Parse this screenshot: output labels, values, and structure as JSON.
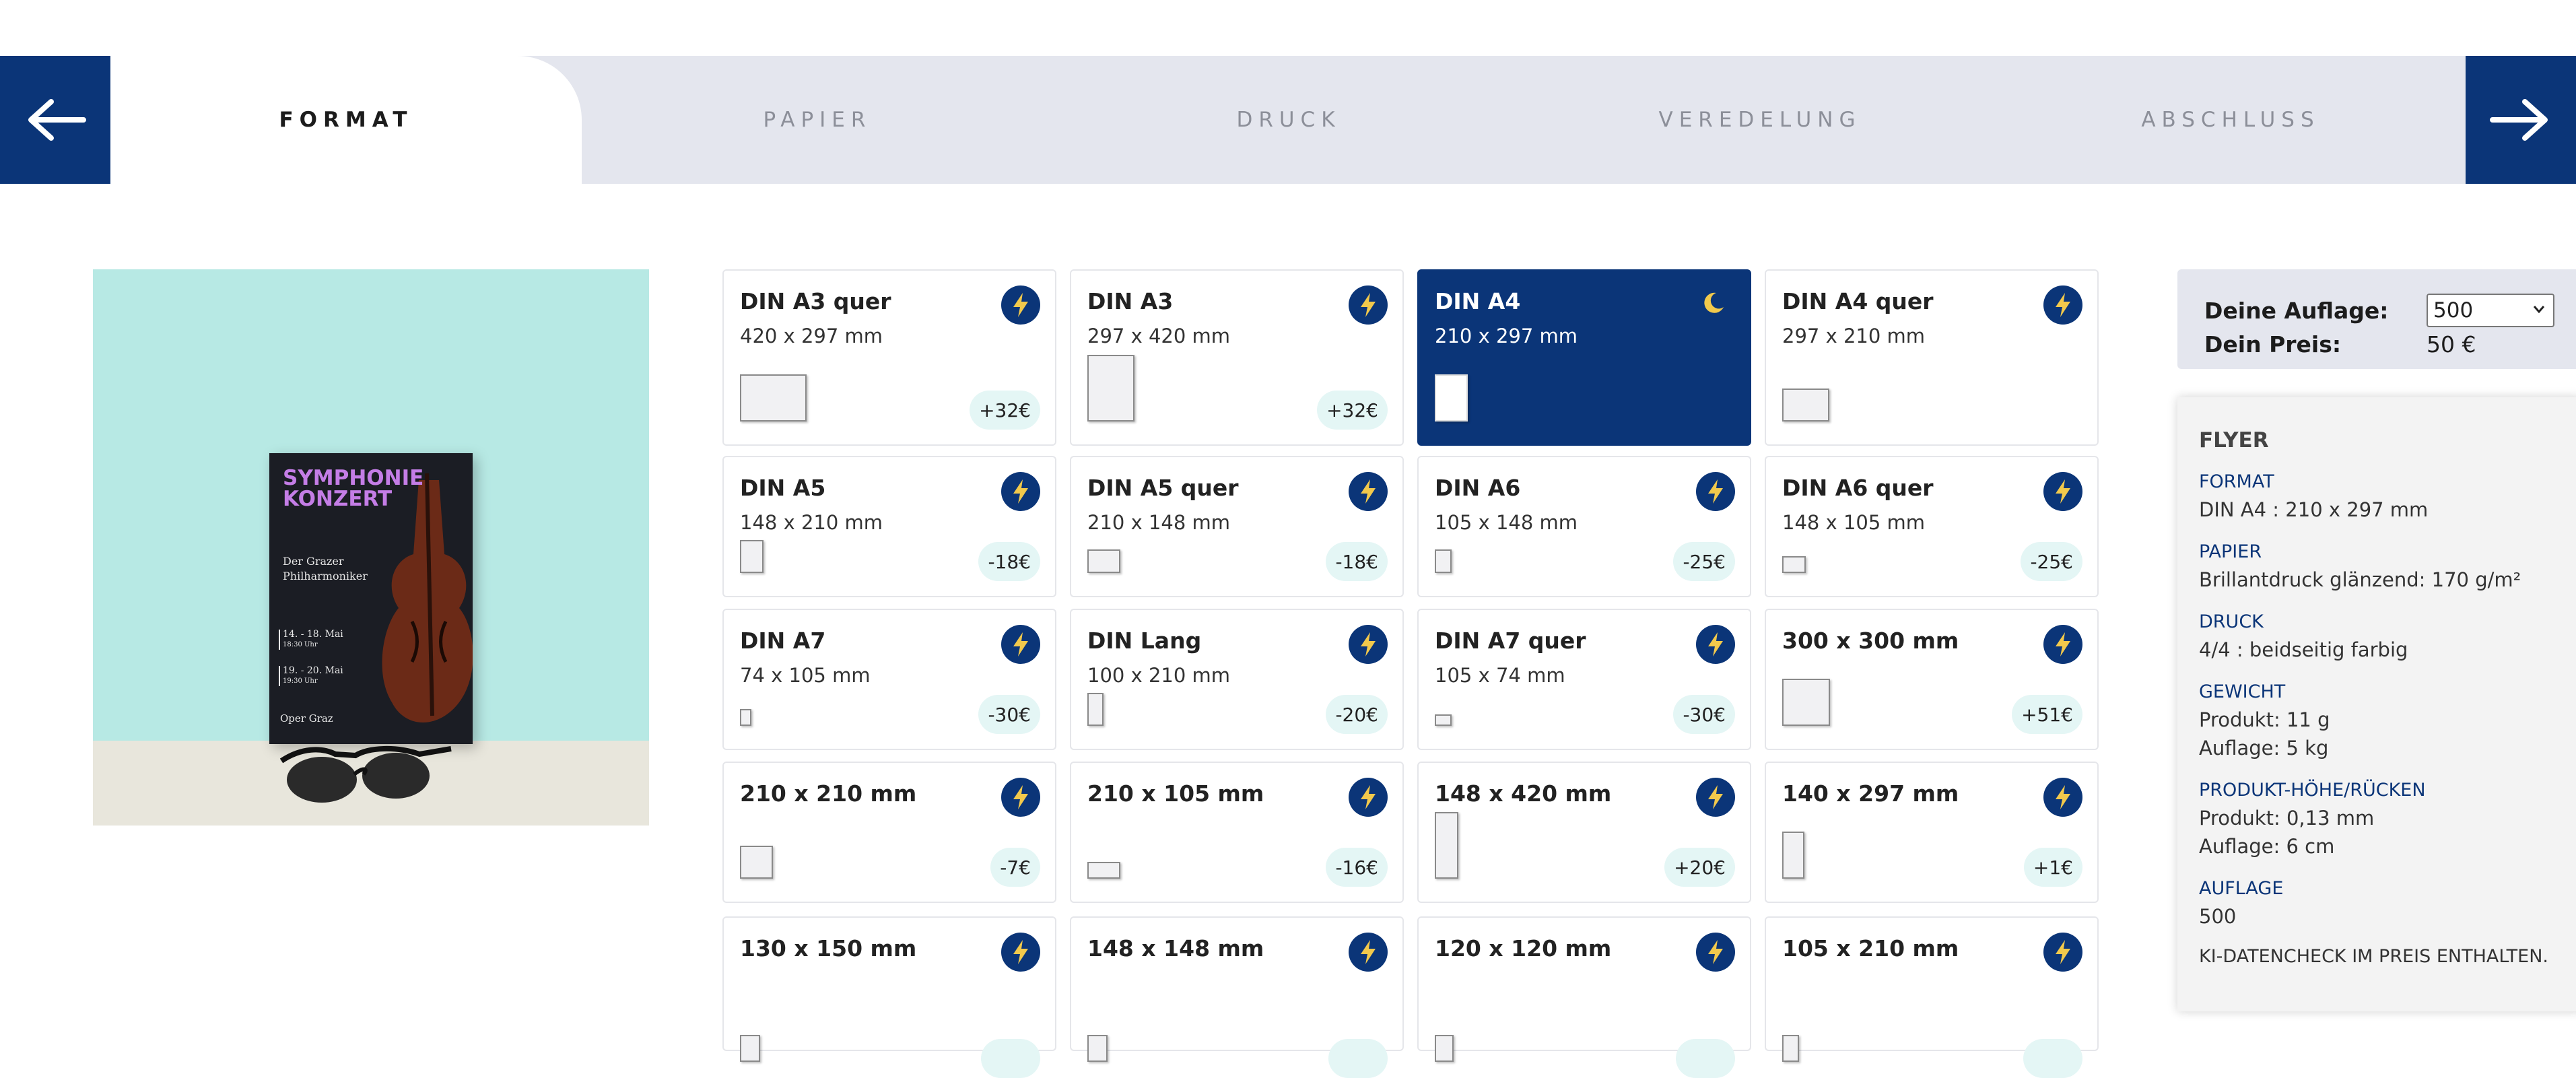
{
  "nav": {
    "prev_label": "←",
    "next_label": "→"
  },
  "steps": [
    {
      "label": "FORMAT",
      "active": true
    },
    {
      "label": "PAPIER",
      "active": false
    },
    {
      "label": "DRUCK",
      "active": false
    },
    {
      "label": "VEREDELUNG",
      "active": false
    },
    {
      "label": "ABSCHLUSS",
      "active": false
    }
  ],
  "poster": {
    "title_line1": "SYMPHONIE",
    "title_line2": "KONZERT",
    "subtitle_line1": "Der Grazer",
    "subtitle_line2": "Philharmoniker",
    "date1": "14. - 18. Mai",
    "time1": "18:30 Uhr",
    "date2": "19. - 20. Mai",
    "time2": "19:30 Uhr",
    "venue": "Oper Graz"
  },
  "formats": [
    {
      "name": "DIN A3 quer",
      "dims": "420 x 297 mm",
      "price": "+32€",
      "icon": "lightning-icon",
      "selected": false
    },
    {
      "name": "DIN A3",
      "dims": "297 x 420 mm",
      "price": "+32€",
      "icon": "lightning-icon",
      "selected": false
    },
    {
      "name": "DIN A4",
      "dims": "210 x 297 mm",
      "price": "",
      "icon": "moon-icon",
      "selected": true
    },
    {
      "name": "DIN A4 quer",
      "dims": "297 x 210 mm",
      "price": "",
      "icon": "lightning-icon",
      "selected": false
    },
    {
      "name": "DIN A5",
      "dims": "148 x 210 mm",
      "price": "-18€",
      "icon": "lightning-icon",
      "selected": false
    },
    {
      "name": "DIN A5 quer",
      "dims": "210 x 148 mm",
      "price": "-18€",
      "icon": "lightning-icon",
      "selected": false
    },
    {
      "name": "DIN A6",
      "dims": "105 x 148 mm",
      "price": "-25€",
      "icon": "lightning-icon",
      "selected": false
    },
    {
      "name": "DIN A6 quer",
      "dims": "148 x 105 mm",
      "price": "-25€",
      "icon": "lightning-icon",
      "selected": false
    },
    {
      "name": "DIN A7",
      "dims": "74 x 105 mm",
      "price": "-30€",
      "icon": "lightning-icon",
      "selected": false
    },
    {
      "name": "DIN Lang",
      "dims": "100 x 210 mm",
      "price": "-20€",
      "icon": "lightning-icon",
      "selected": false
    },
    {
      "name": "DIN A7 quer",
      "dims": "105 x 74 mm",
      "price": "-30€",
      "icon": "lightning-icon",
      "selected": false
    },
    {
      "name": "300 x 300 mm",
      "dims": "",
      "price": "+51€",
      "icon": "lightning-icon",
      "selected": false
    },
    {
      "name": "210 x 210 mm",
      "dims": "",
      "price": "-7€",
      "icon": "lightning-icon",
      "selected": false
    },
    {
      "name": "210 x 105 mm",
      "dims": "",
      "price": "-16€",
      "icon": "lightning-icon",
      "selected": false
    },
    {
      "name": "148 x 420 mm",
      "dims": "",
      "price": "+20€",
      "icon": "lightning-icon",
      "selected": false
    },
    {
      "name": "140 x 297 mm",
      "dims": "",
      "price": "+1€",
      "icon": "lightning-icon",
      "selected": false
    },
    {
      "name": "130 x 150 mm",
      "dims": "",
      "price": "",
      "icon": "lightning-icon",
      "selected": false
    },
    {
      "name": "148 x 148 mm",
      "dims": "",
      "price": "",
      "icon": "lightning-icon",
      "selected": false
    },
    {
      "name": "120 x 120 mm",
      "dims": "",
      "price": "",
      "icon": "lightning-icon",
      "selected": false
    },
    {
      "name": "105 x 210 mm",
      "dims": "",
      "price": "",
      "icon": "lightning-icon",
      "selected": false
    }
  ],
  "order": {
    "quantity_label": "Deine Auflage:",
    "quantity_value": "500",
    "price_label": "Dein Preis:",
    "price_value": "50 €"
  },
  "summary": {
    "heading": "FLYER",
    "format_label": "FORMAT",
    "format_value": "DIN A4 : 210 x 297 mm",
    "paper_label": "PAPIER",
    "paper_value": "Brillantdruck glänzend: 170 g/m²",
    "print_label": "DRUCK",
    "print_value": "4/4 : beidseitig farbig",
    "weight_label": "GEWICHT",
    "weight_product": "Produkt: 11 g",
    "weight_run": "Auflage: 5 kg",
    "height_label": "PRODUKT-HÖHE/RÜCKEN",
    "height_product": "Produkt: 0,13 mm",
    "height_run": "Auflage: 6 cm",
    "run_label": "AUFLAGE",
    "run_value": "500",
    "note": "KI-DATENCHECK IM PREIS ENTHALTEN."
  },
  "colors": {
    "navy": "#0b3578",
    "stepbar": "#e4e6ee",
    "price_pill": "#e4f6f5",
    "wall": "#b7e9e4"
  }
}
